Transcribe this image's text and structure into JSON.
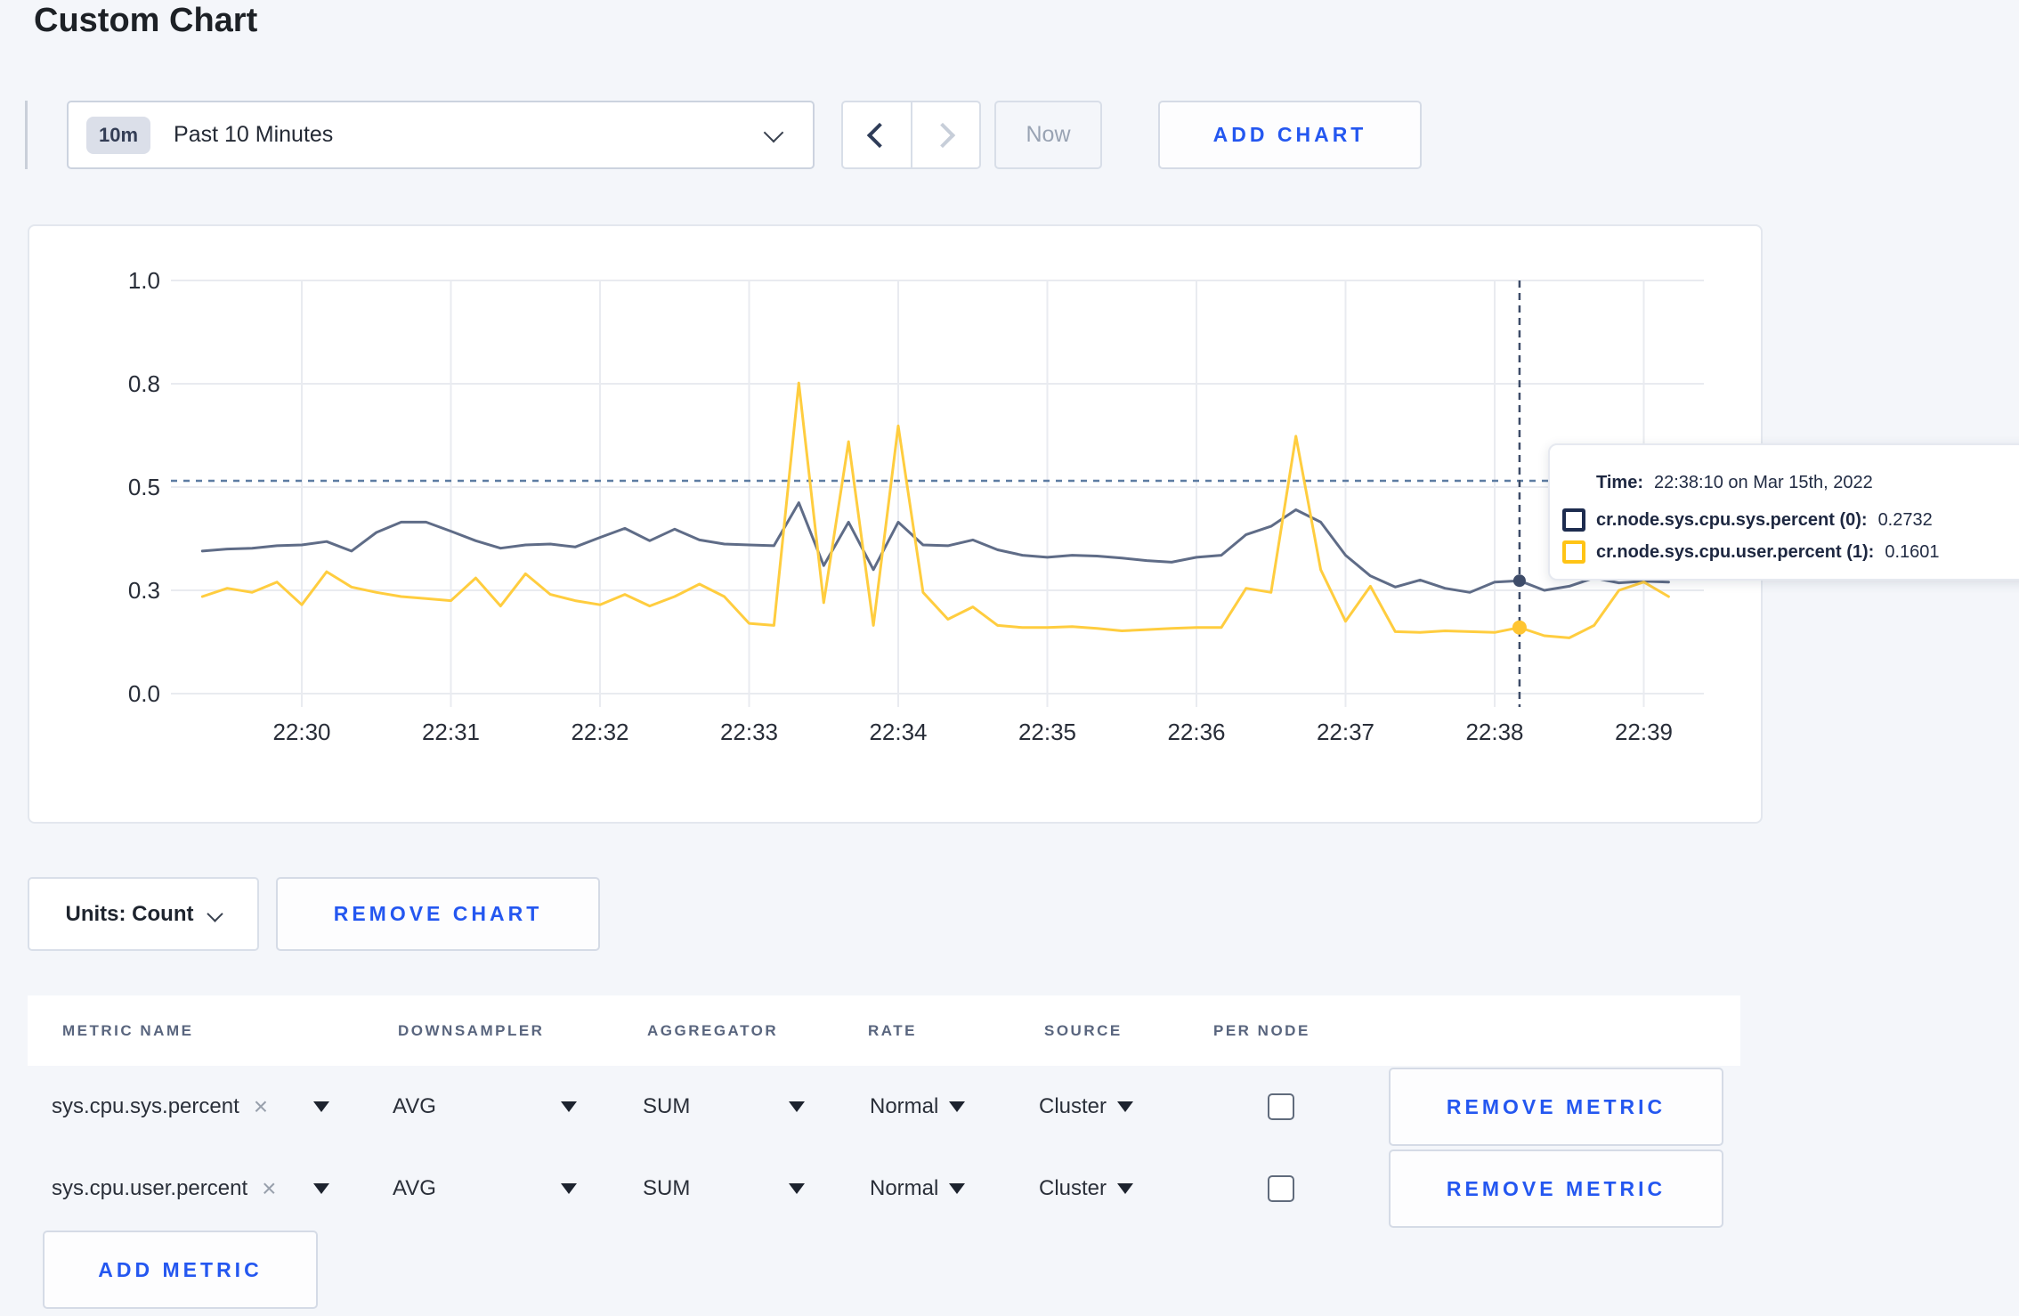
{
  "page": {
    "title": "Custom Chart"
  },
  "toolbar": {
    "range_badge": "10m",
    "range_label": "Past 10 Minutes",
    "now_label": "Now",
    "add_chart_label": "ADD CHART"
  },
  "chart_data": {
    "type": "line",
    "title": "",
    "xlabel": "",
    "ylabel": "",
    "ylim": [
      0,
      1
    ],
    "grid": true,
    "legend_position": "tooltip",
    "x_ticks": [
      "22:30",
      "22:31",
      "22:32",
      "22:33",
      "22:34",
      "22:35",
      "22:36",
      "22:37",
      "22:38",
      "22:39"
    ],
    "y_ticks": [
      {
        "label": "1.0",
        "value": 1.0
      },
      {
        "label": "0.8",
        "value": 0.75
      },
      {
        "label": "0.5",
        "value": 0.5
      },
      {
        "label": "0.3",
        "value": 0.25
      },
      {
        "label": "0.0",
        "value": 0.0
      }
    ],
    "point_interval_seconds": 10,
    "first_point_offset_seconds": -40,
    "series": [
      {
        "name": "cr.node.sys.cpu.sys.percent (0)",
        "color": "#5f6c87",
        "dot_color": "#3e4c69",
        "values": [
          0.345,
          0.35,
          0.352,
          0.358,
          0.36,
          0.368,
          0.345,
          0.39,
          0.415,
          0.415,
          0.393,
          0.37,
          0.352,
          0.36,
          0.362,
          0.355,
          0.378,
          0.4,
          0.37,
          0.398,
          0.372,
          0.362,
          0.36,
          0.358,
          0.462,
          0.31,
          0.415,
          0.3,
          0.415,
          0.36,
          0.358,
          0.372,
          0.348,
          0.335,
          0.33,
          0.335,
          0.333,
          0.328,
          0.322,
          0.318,
          0.33,
          0.335,
          0.385,
          0.405,
          0.445,
          0.415,
          0.335,
          0.285,
          0.258,
          0.275,
          0.255,
          0.245,
          0.27,
          0.2732,
          0.25,
          0.26,
          0.28,
          0.268,
          0.272,
          0.27
        ]
      },
      {
        "name": "cr.node.sys.cpu.user.percent (1)",
        "color": "#ffcd3f",
        "dot_color": "#ffc531",
        "values": [
          0.235,
          0.255,
          0.245,
          0.27,
          0.215,
          0.295,
          0.258,
          0.245,
          0.235,
          0.23,
          0.225,
          0.28,
          0.212,
          0.29,
          0.24,
          0.225,
          0.215,
          0.24,
          0.212,
          0.235,
          0.265,
          0.235,
          0.17,
          0.165,
          0.752,
          0.22,
          0.61,
          0.165,
          0.648,
          0.245,
          0.18,
          0.21,
          0.165,
          0.16,
          0.16,
          0.162,
          0.158,
          0.152,
          0.155,
          0.158,
          0.16,
          0.16,
          0.255,
          0.245,
          0.623,
          0.3,
          0.175,
          0.26,
          0.15,
          0.148,
          0.152,
          0.15,
          0.148,
          0.1601,
          0.14,
          0.135,
          0.165,
          0.25,
          0.27,
          0.235
        ]
      }
    ],
    "hover": {
      "index": 53,
      "time": "22:38:10 on Mar 15th, 2022",
      "hline_value": 0.515
    }
  },
  "tooltip": {
    "time_label": "Time:",
    "time_value": "22:38:10 on Mar 15th, 2022",
    "rows": [
      {
        "label": "cr.node.sys.cpu.sys.percent (0):",
        "value": "0.2732",
        "color": "#1d2c4f"
      },
      {
        "label": "cr.node.sys.cpu.user.percent (1):",
        "value": "0.1601",
        "color": "#ffc416"
      }
    ]
  },
  "chart_controls": {
    "units_label": "Units: Count",
    "remove_chart_label": "REMOVE CHART"
  },
  "metrics_table": {
    "headers": [
      "METRIC NAME",
      "DOWNSAMPLER",
      "AGGREGATOR",
      "RATE",
      "SOURCE",
      "PER NODE"
    ],
    "rows": [
      {
        "metric": "sys.cpu.sys.percent",
        "downsampler": "AVG",
        "aggregator": "SUM",
        "rate": "Normal",
        "source": "Cluster",
        "per_node": false,
        "remove_label": "REMOVE METRIC"
      },
      {
        "metric": "sys.cpu.user.percent",
        "downsampler": "AVG",
        "aggregator": "SUM",
        "rate": "Normal",
        "source": "Cluster",
        "per_node": false,
        "remove_label": "REMOVE METRIC"
      }
    ],
    "add_metric_label": "ADD METRIC"
  }
}
